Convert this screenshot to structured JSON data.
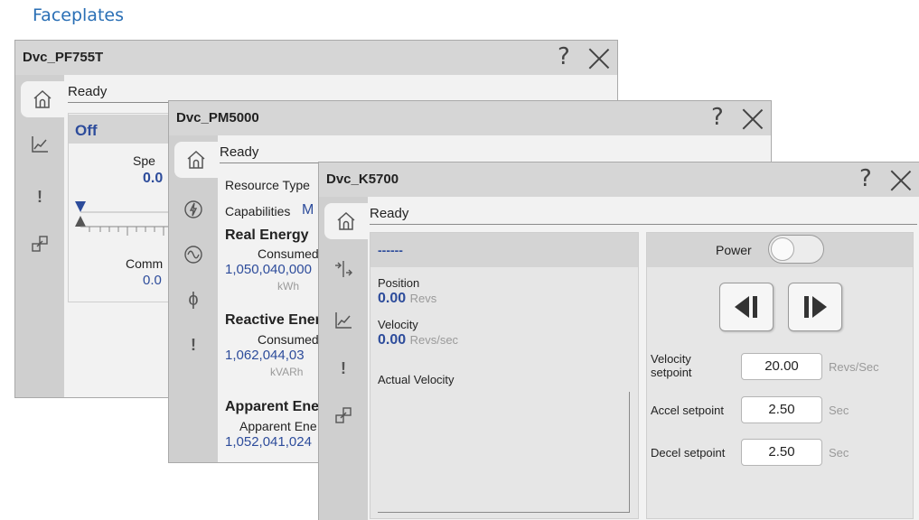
{
  "page": {
    "heading": "Faceplates"
  },
  "faceplates": {
    "pf755t": {
      "title": "Dvc_PF755T",
      "help": "?",
      "status": "Ready",
      "state": "Off",
      "speed_label": "Spe",
      "speed_value": "0.0",
      "command_label": "Comm",
      "command_value": "0.0",
      "nav_icons": [
        "home-icon",
        "trend-icon",
        "alarm-icon",
        "popout-icon"
      ]
    },
    "pm5000": {
      "title": "Dvc_PM5000",
      "help": "?",
      "status": "Ready",
      "resource_type_label": "Resource Type",
      "capabilities_label": "Capabilities",
      "capabilities_value": "M",
      "real_energy": {
        "heading": "Real Energy",
        "label": "Consumed",
        "value": "1,050,040,000",
        "unit": "kWh"
      },
      "reactive_energy": {
        "heading": "Reactive Ener",
        "label": "Consumed",
        "value": "1,062,044,03",
        "unit": "kVARh"
      },
      "apparent_energy": {
        "heading": "Apparent Ene",
        "label": "Apparent Ene",
        "value": "1,052,041,024"
      },
      "nav_icons": [
        "home-icon",
        "lightning-icon",
        "sine-wave-icon",
        "phase-icon",
        "alarm-icon"
      ]
    },
    "k5700": {
      "title": "Dvc_K5700",
      "help": "?",
      "status": "Ready",
      "state_text": "------",
      "position": {
        "label": "Position",
        "value": "0.00",
        "unit": "Revs"
      },
      "velocity": {
        "label": "Velocity",
        "value": "0.00",
        "unit": "Revs/sec"
      },
      "actual_velocity_label": "Actual Velocity",
      "power_label": "Power",
      "power_on": false,
      "jog_reverse_icon": "jog-reverse-icon",
      "jog_forward_icon": "jog-forward-icon",
      "velocity_setpoint": {
        "label_line1": "Velocity",
        "label_line2": "setpoint",
        "value": "20.00",
        "unit": "Revs/Sec"
      },
      "accel_setpoint": {
        "label": "Accel setpoint",
        "value": "2.50",
        "unit": "Sec"
      },
      "decel_setpoint": {
        "label": "Decel setpoint",
        "value": "2.50",
        "unit": "Sec"
      },
      "nav_icons": [
        "home-icon",
        "motion-axis-icon",
        "trend-icon",
        "alarm-icon",
        "popout-icon"
      ]
    }
  },
  "colors": {
    "accent_blue": "#2d4c9b",
    "heading_blue": "#2a6fb5",
    "titlebar": "#d6d6d6",
    "nav": "#cfcfcf"
  }
}
